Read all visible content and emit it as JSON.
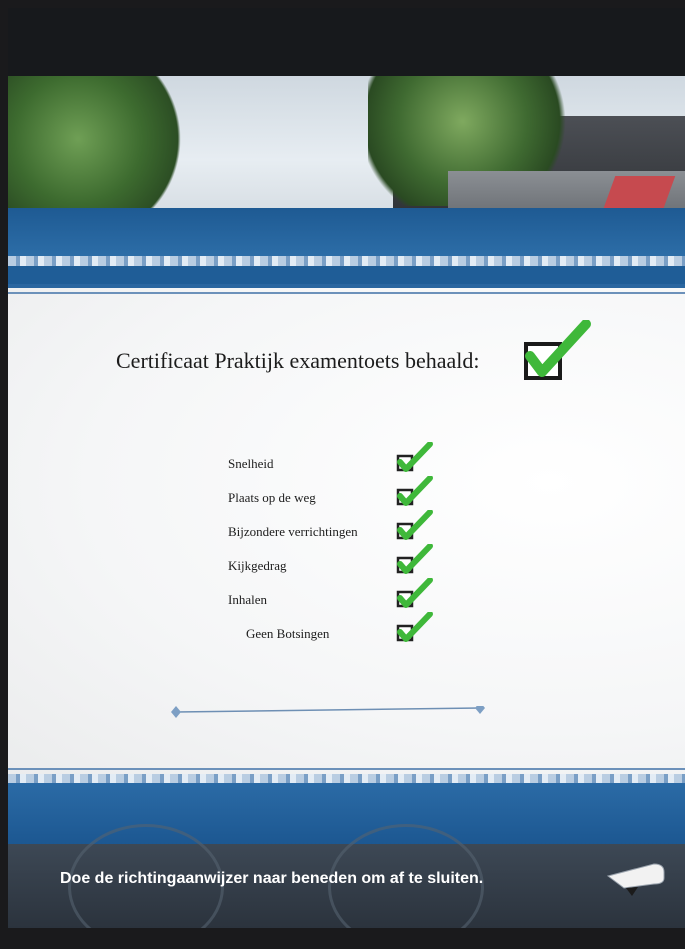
{
  "certificate": {
    "title": "Certificaat Praktijk examentoets behaald:",
    "passed": true
  },
  "criteria": [
    {
      "label": "Snelheid",
      "passed": true
    },
    {
      "label": "Plaats op de weg",
      "passed": true
    },
    {
      "label": "Bijzondere verrichtingen",
      "passed": true
    },
    {
      "label": "Kijkgedrag",
      "passed": true
    },
    {
      "label": "Inhalen",
      "passed": true
    },
    {
      "label": "Geen Botsingen",
      "passed": true
    }
  ],
  "footer": {
    "instruction": "Doe de richtingaanwijzer naar beneden om af te sluiten.",
    "icon": "turn-signal-lever-icon"
  },
  "colors": {
    "check_green": "#3fb83a",
    "panel_blue": "#1f5d97"
  }
}
